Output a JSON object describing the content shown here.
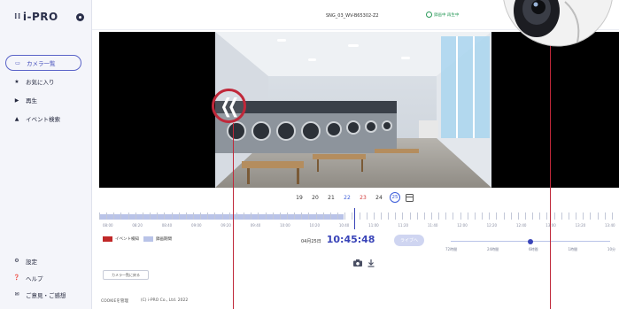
{
  "app": {
    "logo_text": "i-PRO",
    "camera_title": "SNG_03_WV-B65302-Z2",
    "status_text": "録画中 再生中"
  },
  "sidebar": {
    "items": [
      {
        "label": "カメラ一覧",
        "icon": "camera-icon",
        "active": true
      },
      {
        "label": "お気に入り",
        "icon": "star-icon",
        "active": false
      },
      {
        "label": "再生",
        "icon": "play-icon",
        "active": false
      },
      {
        "label": "イベント検索",
        "icon": "bell-icon",
        "active": false
      }
    ],
    "bottom_items": [
      {
        "label": "設定",
        "icon": "gear-icon"
      },
      {
        "label": "ヘルプ",
        "icon": "help-icon"
      },
      {
        "label": "ご意見・ご感想",
        "icon": "mail-icon"
      }
    ]
  },
  "calendar": {
    "days": [
      {
        "label": "19",
        "kind": "normal"
      },
      {
        "label": "20",
        "kind": "normal"
      },
      {
        "label": "21",
        "kind": "normal"
      },
      {
        "label": "22",
        "kind": "sat"
      },
      {
        "label": "23",
        "kind": "sun"
      },
      {
        "label": "24",
        "kind": "normal"
      },
      {
        "label": "25",
        "kind": "today"
      }
    ]
  },
  "timeline": {
    "labels": [
      "08:00",
      "08:20",
      "08:40",
      "09:00",
      "09:20",
      "09:40",
      "10:00",
      "10:20",
      "10:40",
      "11:00",
      "11:20",
      "11:40",
      "12:00",
      "12:20",
      "12:40",
      "13:00",
      "13:20",
      "13:40"
    ],
    "recorded_until_fraction": 0.47,
    "cursor_fraction": 0.49
  },
  "legend": {
    "event_label": "イベント検知",
    "record_label": "録画期間"
  },
  "playback": {
    "date": "04月25日",
    "time": "10:45:48",
    "live_label": "ライブへ"
  },
  "zoom": {
    "labels": [
      "72時間",
      "24時間",
      "6時間",
      "1時間",
      "10分"
    ],
    "level_fraction": 0.5
  },
  "actions": {
    "back_label": "カメラ一覧に戻る"
  },
  "footer": {
    "cookie_label": "COOKIEを管理",
    "copyright": "(C) i-PRO Co., Ltd. 2022"
  },
  "colors": {
    "accent": "#3944b8",
    "highlight": "#c0283a",
    "recorded": "#b9c3e8",
    "event": "#c02828"
  }
}
